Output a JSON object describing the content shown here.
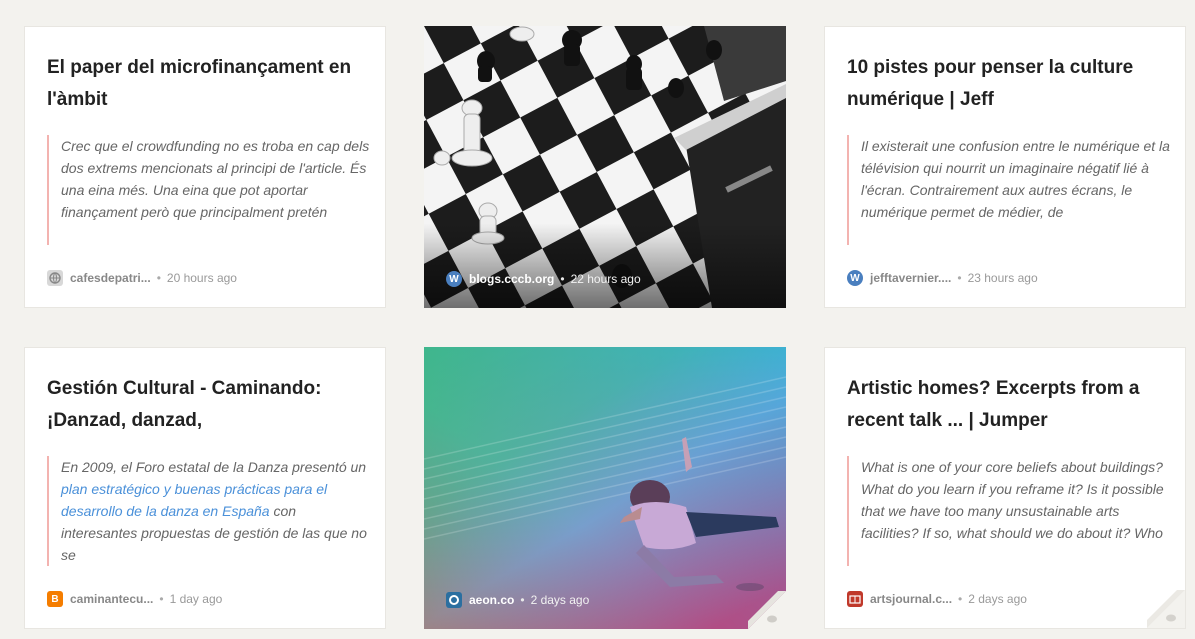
{
  "cards": [
    {
      "title": "El paper del microfinançament en l'àmbit",
      "excerpt": "Crec que el crowdfunding no es troba en cap dels dos extrems mencionats al principi de l'article. És una eina més. Una eina que pot aportar finançament però que principalment pretén",
      "source": "cafesdepatri...",
      "time": "20 hours ago",
      "icon": "globe-icon"
    },
    {
      "source": "blogs.cccb.org",
      "time": "22 hours ago",
      "icon": "wordpress-icon",
      "image": "chess-board-photo"
    },
    {
      "title": "10 pistes pour penser la culture numérique | Jeff",
      "excerpt": "Il existerait une confusion entre le numérique et la télévision qui nourrit un imaginaire négatif lié à l'écran. Contrairement aux autres écrans, le numérique permet de médier, de",
      "source": "jefftavernier....",
      "time": "23 hours ago",
      "icon": "wordpress-icon"
    },
    {
      "title": "Gestión Cultural - Caminando: ¡Danzad, danzad,",
      "excerpt_before": "En 2009, el Foro estatal de la Danza presentó un ",
      "excerpt_link": "plan estratégico y buenas prácticas para el desarrollo de la danza en España",
      "excerpt_after": " con interesantes propuestas de gestión de las que no se",
      "source": "caminantecu...",
      "time": "1 day ago",
      "icon": "blogger-icon"
    },
    {
      "source": "aeon.co",
      "time": "2 days ago",
      "icon": "aeon-icon",
      "image": "dancer-gradient-photo"
    },
    {
      "title": "Artistic homes? Excerpts from a recent talk ... | Jumper",
      "excerpt": "What is one of your core beliefs about buildings? What do you learn if you reframe it? Is it possible that we have too many unsustainable arts facilities? If so, what should we do about it? Who",
      "source": "artsjournal.c...",
      "time": "2 days ago",
      "icon": "artsjournal-icon"
    }
  ],
  "separator": "•",
  "colors": {
    "background": "#f3f2ee",
    "quote_bar": "#f3b3b0",
    "link": "#4a90d9",
    "blogger": "#f57d00",
    "wordpress": "#4a7fbf",
    "artsjournal": "#c0392b"
  }
}
